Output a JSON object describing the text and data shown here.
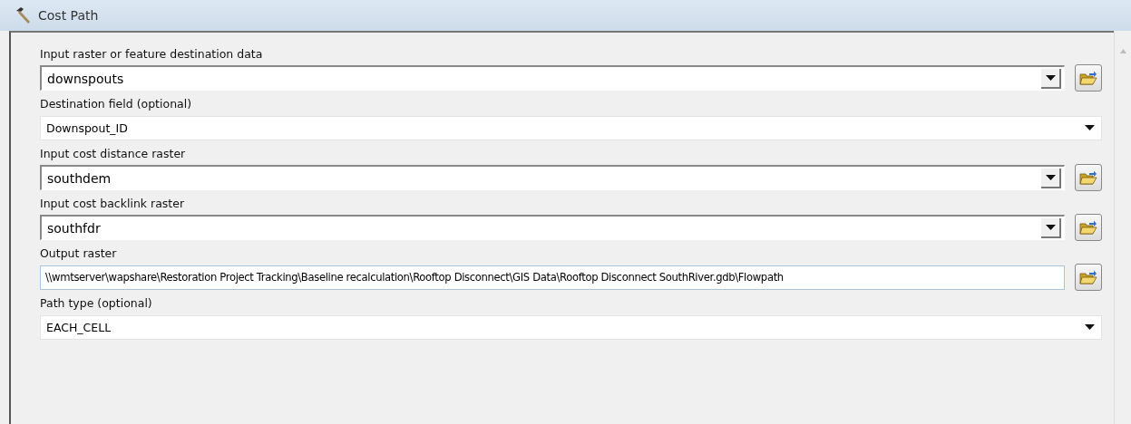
{
  "window": {
    "title": "Cost Path"
  },
  "parameters": [
    {
      "label": "Input raster or feature destination data",
      "kind": "combo",
      "value": "downspouts"
    },
    {
      "label": "Destination field (optional)",
      "kind": "dropdown",
      "value": "Downspout_ID"
    },
    {
      "label": "Input cost distance raster",
      "kind": "combo",
      "value": "southdem"
    },
    {
      "label": "Input cost backlink raster",
      "kind": "combo",
      "value": "southfdr"
    },
    {
      "label": "Output raster",
      "kind": "text",
      "value": "\\\\wmtserver\\wapshare\\Restoration Project Tracking\\Baseline recalculation\\Rooftop Disconnect\\GIS Data\\Rooftop Disconnect SouthRiver.gdb\\Flowpath"
    },
    {
      "label": "Path type (optional)",
      "kind": "dropdown",
      "value": "EACH_CELL"
    }
  ]
}
